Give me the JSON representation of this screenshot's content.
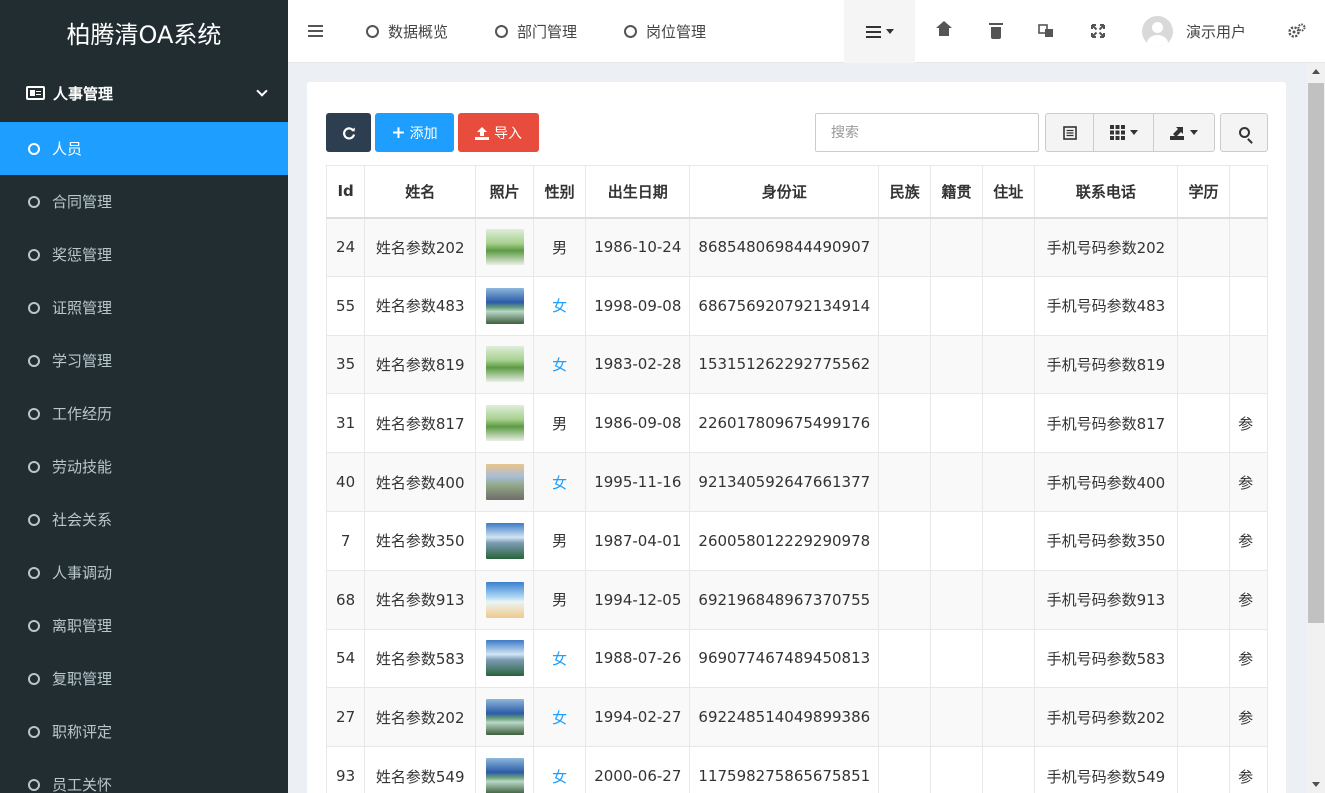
{
  "app": {
    "title": "柏腾清OA系统"
  },
  "sidebar": {
    "group": {
      "label": "人事管理"
    },
    "items": [
      {
        "label": "人员",
        "active": true
      },
      {
        "label": "合同管理"
      },
      {
        "label": "奖惩管理"
      },
      {
        "label": "证照管理"
      },
      {
        "label": "学习管理"
      },
      {
        "label": "工作经历"
      },
      {
        "label": "劳动技能"
      },
      {
        "label": "社会关系"
      },
      {
        "label": "人事调动"
      },
      {
        "label": "离职管理"
      },
      {
        "label": "复职管理"
      },
      {
        "label": "职称评定"
      },
      {
        "label": "员工关怀"
      }
    ]
  },
  "topbar": {
    "tabs": [
      {
        "label": "数据概览"
      },
      {
        "label": "部门管理"
      },
      {
        "label": "岗位管理"
      }
    ],
    "user": {
      "name": "演示用户"
    }
  },
  "toolbar": {
    "add_label": "添加",
    "import_label": "导入",
    "search_placeholder": "搜索"
  },
  "table": {
    "columns": [
      "Id",
      "姓名",
      "照片",
      "性别",
      "出生日期",
      "身份证",
      "民族",
      "籍贯",
      "住址",
      "联系电话",
      "学历"
    ],
    "partial_col_text": "参",
    "rows": [
      {
        "id": "24",
        "name": "姓名参数202",
        "photo": "img-plant",
        "gender": "男",
        "birth": "1986-10-24",
        "idcard": "868548069844490907",
        "phone": "手机号码参数202",
        "extra": ""
      },
      {
        "id": "55",
        "name": "姓名参数483",
        "photo": "img-river",
        "gender": "女",
        "birth": "1998-09-08",
        "idcard": "686756920792134914",
        "phone": "手机号码参数483",
        "extra": ""
      },
      {
        "id": "35",
        "name": "姓名参数819",
        "photo": "img-plant",
        "gender": "女",
        "birth": "1983-02-28",
        "idcard": "153151262292775562",
        "phone": "手机号码参数819",
        "extra": ""
      },
      {
        "id": "31",
        "name": "姓名参数817",
        "photo": "img-plant",
        "gender": "男",
        "birth": "1986-09-08",
        "idcard": "226017809675499176",
        "phone": "手机号码参数817",
        "extra": "参"
      },
      {
        "id": "40",
        "name": "姓名参数400",
        "photo": "img-road",
        "gender": "女",
        "birth": "1995-11-16",
        "idcard": "921340592647661377",
        "phone": "手机号码参数400",
        "extra": "参"
      },
      {
        "id": "7",
        "name": "姓名参数350",
        "photo": "img-mountain",
        "gender": "男",
        "birth": "1987-04-01",
        "idcard": "260058012229290978",
        "phone": "手机号码参数350",
        "extra": "参"
      },
      {
        "id": "68",
        "name": "姓名参数913",
        "photo": "img-beach",
        "gender": "男",
        "birth": "1994-12-05",
        "idcard": "692196848967370755",
        "phone": "手机号码参数913",
        "extra": "参"
      },
      {
        "id": "54",
        "name": "姓名参数583",
        "photo": "img-mountain",
        "gender": "女",
        "birth": "1988-07-26",
        "idcard": "969077467489450813",
        "phone": "手机号码参数583",
        "extra": "参"
      },
      {
        "id": "27",
        "name": "姓名参数202",
        "photo": "img-river",
        "gender": "女",
        "birth": "1994-02-27",
        "idcard": "692248514049899386",
        "phone": "手机号码参数202",
        "extra": "参"
      },
      {
        "id": "93",
        "name": "姓名参数549",
        "photo": "img-river",
        "gender": "女",
        "birth": "2000-06-27",
        "idcard": "117598275865675851",
        "phone": "手机号码参数549",
        "extra": "参"
      }
    ]
  },
  "colors": {
    "sidebar_bg": "#222d32",
    "accent": "#1e9fff",
    "danger": "#e74c3c",
    "dark_btn": "#2c3e50"
  }
}
